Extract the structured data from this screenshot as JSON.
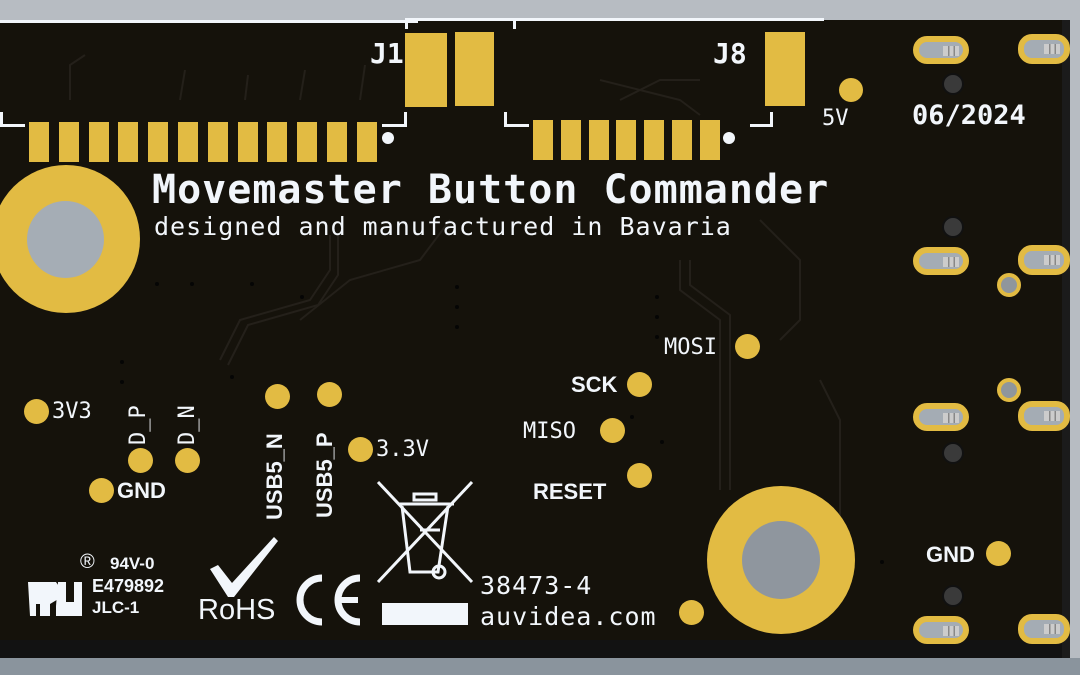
{
  "board": {
    "title": "Movemaster Button Commander",
    "subtitle": "designed and manufactured in Bavaria",
    "date": "06/2024",
    "part_number": "38473-4",
    "website": "auvidea.com"
  },
  "connectors": {
    "j1": {
      "label": "J1",
      "pin_count": 12
    },
    "j8": {
      "label": "J8",
      "pin_count": 7
    }
  },
  "test_points": {
    "five_v": "5V",
    "three_v3": "3V3",
    "d_p": "D_P",
    "d_n": "D_N",
    "gnd_left": "GND",
    "usb5_n": "USB5_N",
    "usb5_p": "USB5_P",
    "three_point_three_v": "3.3V",
    "mosi": "MOSI",
    "sck": "SCK",
    "miso": "MISO",
    "reset": "RESET",
    "gnd_right": "GND"
  },
  "certifications": {
    "ul_registered": "®",
    "flammability": "94V-0",
    "ul_file": "E479892",
    "manufacturer_code": "JLC-1",
    "rohs": "RoHS",
    "ce": "CE"
  },
  "icons": {
    "ul_logo": "ul-recognized-icon",
    "rohs_check": "checkmark-icon",
    "ce_mark": "ce-mark-icon",
    "weee_bin": "crossed-bin-icon"
  },
  "colors": {
    "soldermask": "#15120b",
    "copper_pad": "#e2bb43",
    "silkscreen": "#f2f6fb",
    "drill_hole": "#a5adb5",
    "background": "#b7bcc2"
  }
}
